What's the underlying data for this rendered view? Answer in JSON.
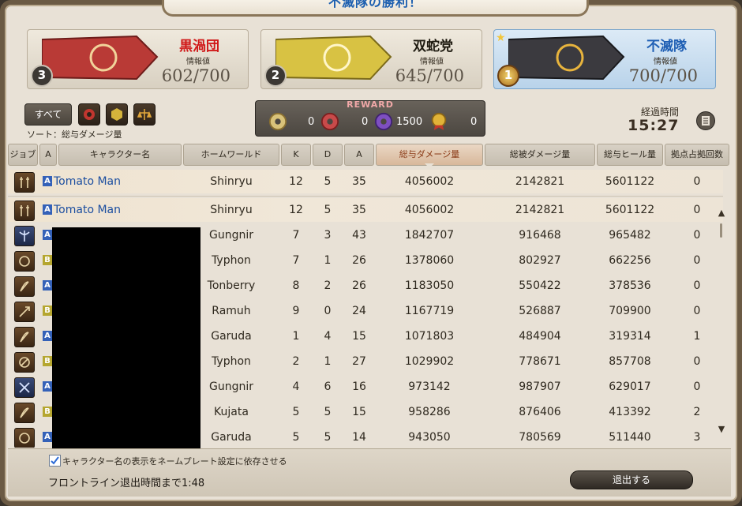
{
  "title": "不滅隊の勝利！",
  "grand_companies": [
    {
      "name": "黒渦団",
      "info_label": "情報値",
      "value": "602/700",
      "rank": "3",
      "name_color": "#d01818",
      "banner_color": "#b93a36"
    },
    {
      "name": "双蛇党",
      "info_label": "情報値",
      "value": "645/700",
      "rank": "2",
      "name_color": "#1e1a10",
      "banner_color": "#d8c243"
    },
    {
      "name": "不滅隊",
      "info_label": "情報値",
      "value": "700/700",
      "rank": "1",
      "name_color": "#1f5fb4",
      "banner_color": "#3b3a3f"
    }
  ],
  "filters": {
    "all_label": "すべて",
    "icons": [
      "maelstrom-filter-icon",
      "twin-adder-filter-icon",
      "immortal-flames-filter-icon"
    ],
    "sort_label": "ソート：総与ダメージ量"
  },
  "reward": {
    "title": "REWARD",
    "items": [
      {
        "icon": "gold-seal-icon",
        "value": "0"
      },
      {
        "icon": "red-seal-icon",
        "value": "0"
      },
      {
        "icon": "purple-seal-icon",
        "value": "1500"
      },
      {
        "icon": "medal-icon",
        "value": "0"
      }
    ]
  },
  "elapsed": {
    "label": "経過時間",
    "time": "15:27"
  },
  "table": {
    "headers": [
      "ジョブ",
      "A",
      "キャラクター名",
      "ホームワールド",
      "K",
      "D",
      "A",
      "総与ダメージ量",
      "総被ダメージ量",
      "総与ヒール量",
      "拠点占拠回数"
    ],
    "self_row": {
      "alliance": "A",
      "name": "Tomato Man",
      "world": "Shinryu",
      "k": "12",
      "d": "5",
      "a": "35",
      "dmg": "4056002",
      "taken": "2142821",
      "heal": "5601122",
      "cap": "0"
    },
    "rows": [
      {
        "alliance": "A",
        "name": "Tomato Man",
        "world": "Shinryu",
        "k": "12",
        "d": "5",
        "a": "35",
        "dmg": "4056002",
        "taken": "2142821",
        "heal": "5601122",
        "cap": "0"
      },
      {
        "alliance": "A",
        "name": "",
        "world": "Gungnir",
        "k": "7",
        "d": "3",
        "a": "43",
        "dmg": "1842707",
        "taken": "916468",
        "heal": "965482",
        "cap": "0"
      },
      {
        "alliance": "B",
        "name": "",
        "world": "Typhon",
        "k": "7",
        "d": "1",
        "a": "26",
        "dmg": "1378060",
        "taken": "802927",
        "heal": "662256",
        "cap": "0"
      },
      {
        "alliance": "A",
        "name": "",
        "world": "Tonberry",
        "k": "8",
        "d": "2",
        "a": "26",
        "dmg": "1183050",
        "taken": "550422",
        "heal": "378536",
        "cap": "0"
      },
      {
        "alliance": "B",
        "name": "",
        "world": "Ramuh",
        "k": "9",
        "d": "0",
        "a": "24",
        "dmg": "1167719",
        "taken": "526887",
        "heal": "709900",
        "cap": "0"
      },
      {
        "alliance": "A",
        "name": "",
        "world": "Garuda",
        "k": "1",
        "d": "4",
        "a": "15",
        "dmg": "1071803",
        "taken": "484904",
        "heal": "319314",
        "cap": "1"
      },
      {
        "alliance": "B",
        "name": "",
        "world": "Typhon",
        "k": "2",
        "d": "1",
        "a": "27",
        "dmg": "1029902",
        "taken": "778671",
        "heal": "857708",
        "cap": "0"
      },
      {
        "alliance": "A",
        "name": "",
        "world": "Gungnir",
        "k": "4",
        "d": "6",
        "a": "16",
        "dmg": "973142",
        "taken": "987907",
        "heal": "629017",
        "cap": "0"
      },
      {
        "alliance": "B",
        "name": "",
        "world": "Kujata",
        "k": "5",
        "d": "5",
        "a": "15",
        "dmg": "958286",
        "taken": "876406",
        "heal": "413392",
        "cap": "2"
      },
      {
        "alliance": "A",
        "name": "",
        "world": "Garuda",
        "k": "5",
        "d": "5",
        "a": "14",
        "dmg": "943050",
        "taken": "780569",
        "heal": "511440",
        "cap": "3"
      }
    ]
  },
  "footer": {
    "checkbox_label": "キャラクター名の表示をネームプレート設定に依存させる",
    "checkbox_checked": true,
    "exit_time": "フロントライン退出時間まで1:48",
    "exit_button": "退出する"
  }
}
